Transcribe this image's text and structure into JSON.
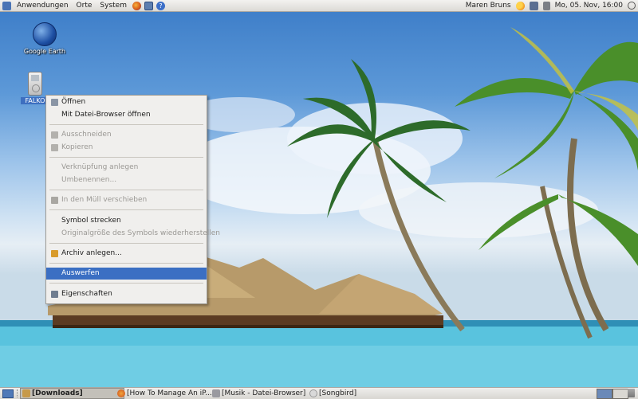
{
  "top_panel": {
    "menus": [
      "Anwendungen",
      "Orte",
      "System"
    ],
    "user_name": "Maren Bruns",
    "clock": "Mo, 05. Nov, 16:00",
    "icons": [
      "distributor-logo-icon",
      "firefox-icon",
      "mail-icon",
      "help-icon",
      "weather-icon",
      "network-icon",
      "volume-icon",
      "power-icon"
    ]
  },
  "desktop": {
    "icons": [
      {
        "name": "google-earth-icon",
        "label": "Google Earth"
      },
      {
        "name": "ipod-drive-icon",
        "label": "FALKO"
      }
    ]
  },
  "context_menu": {
    "items": [
      {
        "label": "Öffnen",
        "enabled": true,
        "icon": "open-icon"
      },
      {
        "label": "Mit Datei-Browser öffnen",
        "enabled": true
      },
      {
        "label": "Ausschneiden",
        "enabled": false,
        "icon": "cut-icon"
      },
      {
        "label": "Kopieren",
        "enabled": false,
        "icon": "copy-icon"
      },
      {
        "label": "Verknüpfung anlegen",
        "enabled": false
      },
      {
        "label": "Umbenennen...",
        "enabled": false
      },
      {
        "label": "In den Müll verschieben",
        "enabled": false,
        "icon": "trash-icon"
      },
      {
        "label": "Symbol strecken",
        "enabled": true
      },
      {
        "label": "Originalgröße des Symbols wiederherstellen",
        "enabled": false
      },
      {
        "label": "Archiv anlegen...",
        "enabled": true,
        "icon": "archive-icon"
      },
      {
        "label": "Auswerfen",
        "enabled": true,
        "highlighted": true
      },
      {
        "label": "Eigenschaften",
        "enabled": true,
        "icon": "properties-icon"
      }
    ]
  },
  "taskbar": {
    "tasks": [
      {
        "label": "[Downloads]",
        "active": true
      },
      {
        "label": "[How To Manage An iP..."
      },
      {
        "label": "[Musik - Datei-Browser]"
      },
      {
        "label": "[Songbird]"
      }
    ]
  },
  "colors": {
    "menu_highlight": "#3b6fc3",
    "panel": "#dcdad5",
    "sea": "#58c2dd"
  }
}
